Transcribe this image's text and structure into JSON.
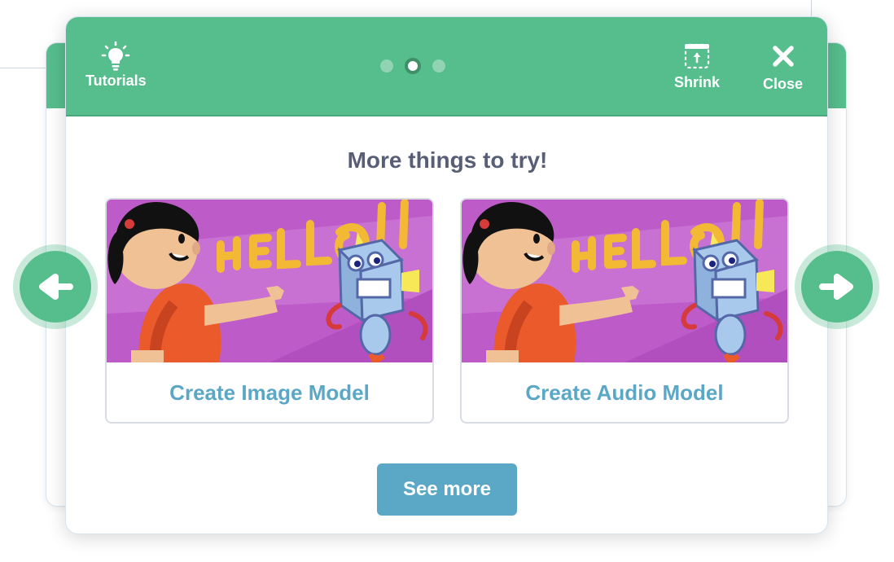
{
  "header": {
    "tutorials_label": "Tutorials",
    "shrink_label": "Shrink",
    "close_label": "Close",
    "icons": {
      "tutorials": "lightbulb-icon",
      "shrink": "shrink-icon",
      "close": "close-icon"
    },
    "pagination": {
      "total": 3,
      "active_index": 1
    }
  },
  "main": {
    "title": "More things to try!",
    "tiles": [
      {
        "label": "Create Image Model"
      },
      {
        "label": "Create Audio Model"
      }
    ],
    "see_more_label": "See more"
  },
  "colors": {
    "header_green": "#56bd8d",
    "tile_label_blue": "#5ba7c6",
    "title_gray": "#575e75",
    "thumb_purple": "#bd5cc8"
  },
  "nav": {
    "prev_icon": "arrow-left-icon",
    "next_icon": "arrow-right-icon"
  }
}
